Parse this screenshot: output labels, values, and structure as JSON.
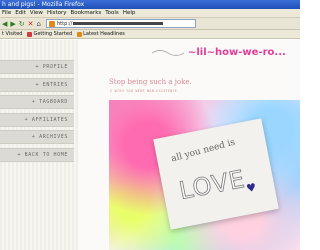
{
  "window": {
    "title": "h and pigs! - Mozilla Firefox"
  },
  "menubar": {
    "items": [
      "File",
      "Edit",
      "View",
      "History",
      "Bookmarks",
      "Tools",
      "Help"
    ]
  },
  "navbar": {
    "url_prefix": "http://"
  },
  "bookmarks": {
    "items": [
      {
        "label": "t Visited",
        "color": "#888888"
      },
      {
        "label": "Getting Started",
        "color": "#d43a3a"
      },
      {
        "label": "Latest Headlines",
        "color": "#e08a1a"
      }
    ]
  },
  "site": {
    "header_text": "~lil~how-we-ro...",
    "nav": [
      {
        "label": "+ PROFILE"
      },
      {
        "label": "+ ENTRIES"
      },
      {
        "label": "+ TAGBOARD"
      },
      {
        "label": "+ AFFILIATES"
      },
      {
        "label": "+ ARCHIVES"
      },
      {
        "label": "+ BACK TO HOME"
      }
    ],
    "title": "Stop being such a joke.",
    "subtitle": "I WISH YOU WERE NON-EXISTENCE.",
    "card": {
      "line1": "all you need is",
      "line2": "LOVE"
    }
  }
}
